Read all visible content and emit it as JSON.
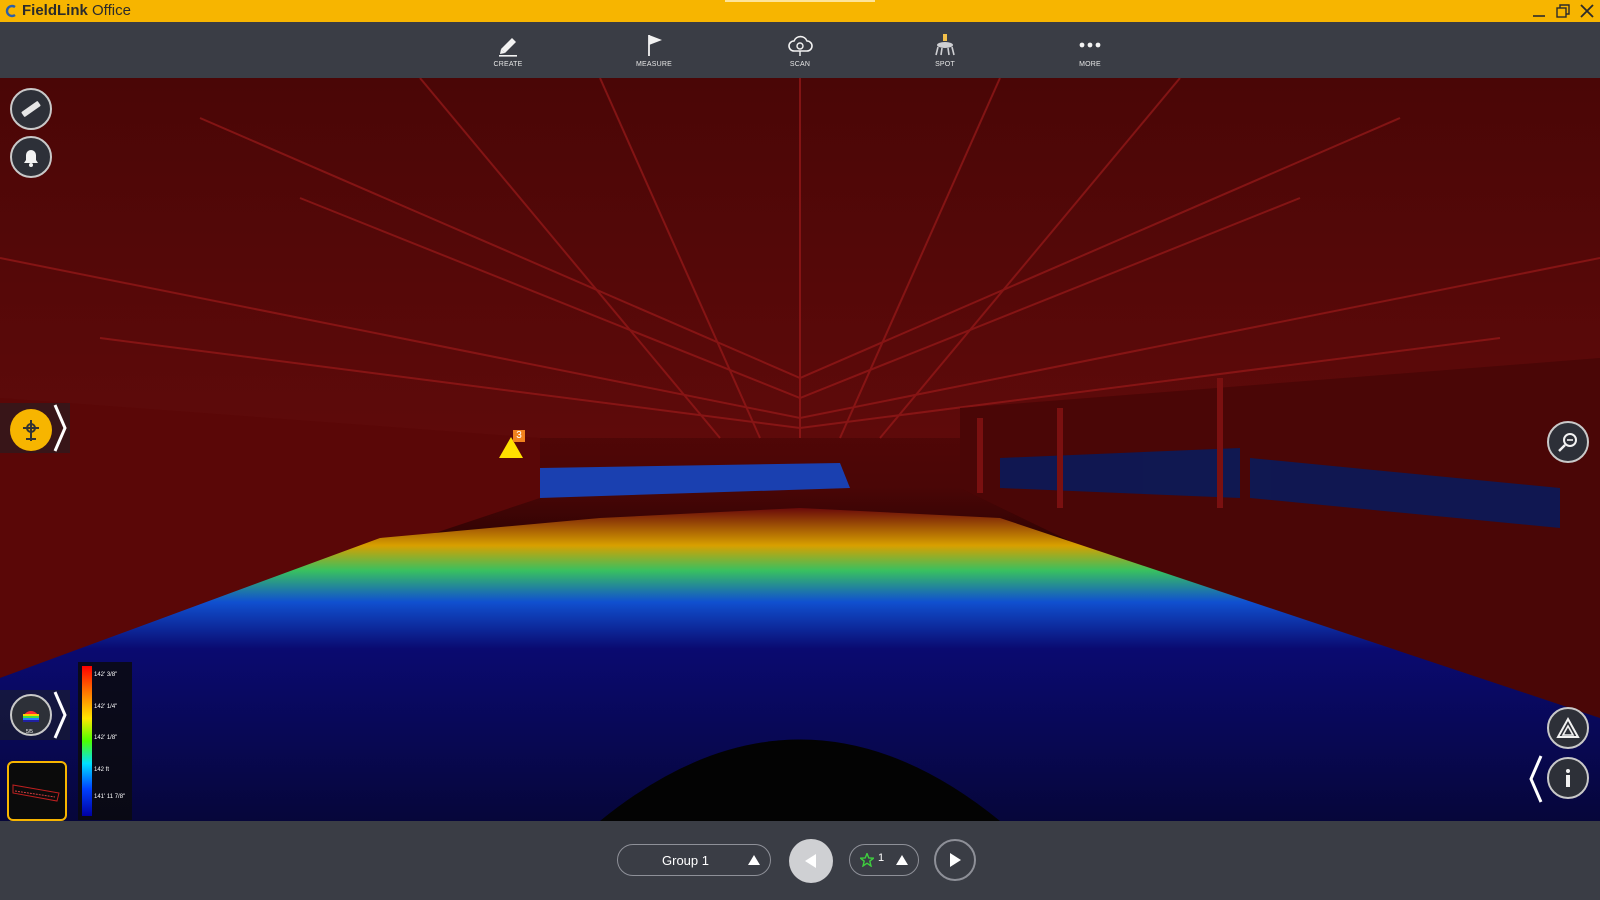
{
  "app": {
    "title_bold": "FieldLink",
    "title_light": " Office",
    "logo_icon": "fieldlink-logo-icon",
    "accent_color": "#f7b500"
  },
  "window_controls": [
    {
      "name": "minimize-icon",
      "glyph": "—"
    },
    {
      "name": "maximize-icon",
      "glyph": "❐"
    },
    {
      "name": "close-icon",
      "glyph": "✕"
    }
  ],
  "toolbar": {
    "items": [
      {
        "label": "CREATE",
        "icon": "pencil-icon"
      },
      {
        "label": "MEASURE",
        "icon": "flag-icon"
      },
      {
        "label": "SCAN",
        "icon": "cloud-scan-icon"
      },
      {
        "label": "SPOT",
        "icon": "spot-robot-icon"
      },
      {
        "label": "MORE",
        "icon": "more-dots-icon"
      }
    ]
  },
  "left_tools": [
    {
      "name": "ruler-icon"
    },
    {
      "name": "bell-icon"
    }
  ],
  "scan_position_button": {
    "icon": "scan-position-icon"
  },
  "color_scale_button": {
    "icon": "color-scale-icon",
    "count": "5/5"
  },
  "legend": {
    "labels": [
      "142' 3/8\"",
      "142' 1/4\"",
      "142' 1/8\"",
      "142 ft",
      "141' 11 7/8\""
    ],
    "colors": [
      "#ff0000",
      "#ffe600",
      "#4cff00",
      "#00e0ff",
      "#0000a0"
    ]
  },
  "warning_marker": {
    "count": "3",
    "icon": "warning-triangle-icon"
  },
  "right_tools": [
    {
      "name": "zoom-icon"
    },
    {
      "name": "triangle-icon"
    },
    {
      "name": "info-icon"
    }
  ],
  "bottom": {
    "group_label": "Group 1",
    "star_count": "1",
    "prev_icon": "play-left-icon",
    "next_icon": "play-right-icon",
    "star_icon": "star-icon"
  }
}
